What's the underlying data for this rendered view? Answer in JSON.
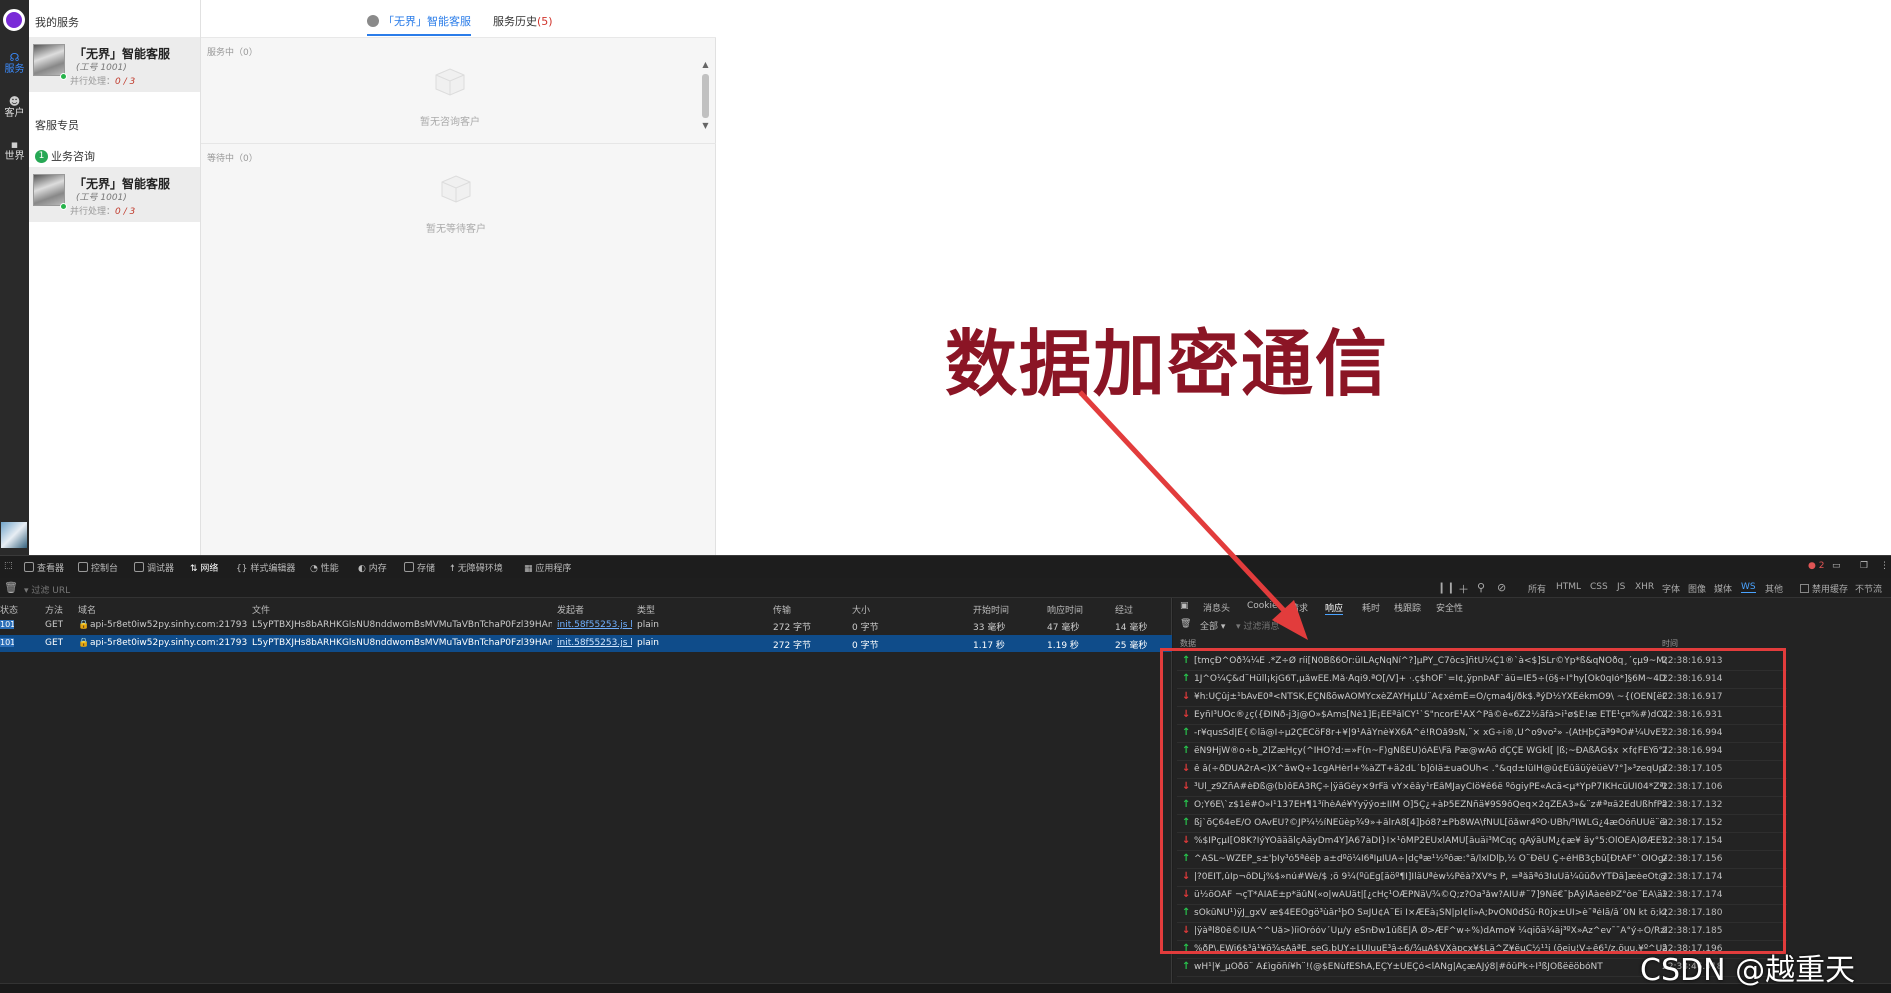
{
  "rail": {
    "items": [
      {
        "label": "服务",
        "icon": "headset-icon",
        "active": true
      },
      {
        "label": "客户",
        "icon": "customers-icon",
        "active": false
      },
      {
        "label": "世界",
        "icon": "chat-icon",
        "active": false
      }
    ]
  },
  "sidebar": {
    "my_services_title": "我的服务",
    "agent_card": {
      "name": "「无界」智能客服",
      "work_id": "(工号 1001)",
      "parallel_label": "并行处理：",
      "parallel_count": "0 / 3"
    },
    "dedicated_title": "客服专员",
    "biz_badge": "1",
    "biz_label": "业务咨询",
    "agent_card2": {
      "name": "「无界」智能客服",
      "work_id": "(工号 1001)",
      "parallel_label": "并行处理：",
      "parallel_count": "0 / 3"
    }
  },
  "middle": {
    "tab_active": "「无界」智能客服",
    "tab_history": "服务历史",
    "tab_history_count": "(5)",
    "serving_label": "服务中（0）",
    "serving_empty": "暂无咨询客户",
    "waiting_label": "等待中（0）",
    "waiting_empty": "暂无等待客户"
  },
  "annotation": {
    "text": "数据加密通信",
    "color": "#8b1525",
    "arrow_color": "#e23c3c"
  },
  "devtools": {
    "tabs": [
      "查看器",
      "控制台",
      "调试器",
      "网络",
      "样式编辑器",
      "性能",
      "内存",
      "存储",
      "无障碍环境",
      "应用程序"
    ],
    "active_tab": "网络",
    "filter_placeholder": "过滤 URL",
    "types": [
      "所有",
      "HTML",
      "CSS",
      "JS",
      "XHR",
      "字体",
      "图像",
      "媒体",
      "WS",
      "其他"
    ],
    "active_type": "WS",
    "disable_cache": "禁用缓存",
    "throttle": "不节流",
    "error_count": "2",
    "columns": [
      "状态",
      "方法",
      "域名",
      "文件",
      "发起者",
      "类型",
      "传输",
      "大小",
      "开始时间",
      "响应时间",
      "经过"
    ],
    "requests": [
      {
        "status": "101",
        "method": "GET",
        "domain": "api-5r8et0iw52py.sinhy.com:21793",
        "file": "L5yPTBXJHs8bARHKGlsNU8nddwomBsMVMuTaVBnTchaP0Fzl39HAm5U3G7l",
        "initiator": "init.58f55253.js l...",
        "type": "plain",
        "transfer": "272 字节",
        "size": "0 字节",
        "start": "33 毫秒",
        "response": "47 毫秒",
        "elapsed": "14 毫秒",
        "selected": false
      },
      {
        "status": "101",
        "method": "GET",
        "domain": "api-5r8et0iw52py.sinhy.com:21793",
        "file": "L5yPTBXJHs8bARHKGlsNU8nddwomBsMVMuTaVBnTchaP0Fzl39HAm5U3G7l",
        "initiator": "init.58f55253.js l...",
        "type": "plain",
        "transfer": "272 字节",
        "size": "0 字节",
        "start": "1.17 秒",
        "response": "1.19 秒",
        "elapsed": "25 毫秒",
        "selected": true
      }
    ],
    "ws_tabs": [
      "消息头",
      "Cookie",
      "请求",
      "响应",
      "耗时",
      "栈跟踪",
      "安全性"
    ],
    "ws_active_tab": "响应",
    "ws_filter_all": "全部",
    "ws_filter_placeholder": "过滤消息",
    "ws_col_data": "数据",
    "ws_col_time": "时间",
    "messages": [
      {
        "dir": "up",
        "data": "[tmçÐ^Ôð¾¼È .*Z÷Ø ríi[Ñ0Bß6Ôr:üILAçÑqÑí^?]µPY_C7ôcs]ñtÜ¼Ç1®`à<$]SLr©Yp*ß&qÑÔðq¸´çµ9~M@X#Ú/e*É¢þ...",
        "time": "22:38:16.913"
      },
      {
        "dir": "up",
        "data": "1J^Ó¼Ç&d¨Hüll¡kjG6T,µåwÈE.Må·Åqi9.ªÓ[/V]+ ·.ç$hÖF`=Î¢,ÿpnÞÂF`áü=ÎÈ5÷(ö§÷Î°hy[Ók0qÍó*]§6M~4DX>Êj»³üò...",
        "time": "22:38:16.914"
      },
      {
        "dir": "dn",
        "data": "¥h:ÙÇûj±¹bÂvÉ0ª<ÑTSK,ÈÇNßõwÂÔMYcxèZÀYHµLÚ¨A¢xémÈ=Ö/çma4j/ðk$.ªýD½ÝXÊékmÓ9\\ ~{(ÔEN[ëÔ»¥¼£ÌK~mi...",
        "time": "22:38:16.917"
      },
      {
        "dir": "dn",
        "data": "ÈyñÌ³ÜOc®¿ç({ÐÌNð-j3j@Ö»$Âms[Nè1]Ê¡ÊÊªâlCY¹`S\"ncorÉ¹ÄX^Pâ©è«6Z2½ãfà>i¹ø$Ê!æ ÊTÈ¹ç¤%#)dÖ{ßÉ9gP®.1·á...",
        "time": "22:38:16.931"
      },
      {
        "dir": "up",
        "data": "-r¥qusSd|É{©lä@Î÷µ2ÇÈCöF8r+¥|9¹ÄâYnè¥X6Å^é!RÓå9sN,¨× xG÷i®,Û^o9vo²» -(ÄtHþÇäª9ªÖ#¼ÛvÈ¹19÷ªkÎÞèi...",
        "time": "22:38:16.994"
      },
      {
        "dir": "up",
        "data": "ëN9HjW®o÷b_2lZæHçy(^ÎHÖ?d:=»F(n~F)gNßÉÛ)óÂÉ\\Fä Pæ@wAö dÇÇÈ WGkÎ[ |ß;~ÐÂßÅG$x ×f¢FEYõ°TØãüÝjÄL...",
        "time": "22:38:16.994"
      },
      {
        "dir": "dn",
        "data": "ê â(÷ðDÚA2rA<)X^åwQ÷1cgÂHèrl+%àZT+ä2dL´b]ôÎä±uaÔÜh< .°&qd±ÎüIH@û¢ÉûäüÿèüèV?°]»³zeqÜpü~ÐÈ¥½...",
        "time": "22:38:17.105"
      },
      {
        "dir": "dn",
        "data": "³Ul_z9ZñÂ#èÐß@(b)ôÈÂ3RÇ÷|ÿäGéy×9rFä vY×êây¹rÈâMJayCÍö¥ê6ë ºôgiyPE«Acä<µ*ÝpP7ÎKHcüÙÍ04*ZªÛ±ÝÄÜ...",
        "time": "22:38:17.106"
      },
      {
        "dir": "up",
        "data": "Ö;Ý6Ë\\`z$1ë#Õ»Î¹137ÉH¶1³íhèÂé¥Ýyÿýo±ÎIM Ó]5Ç¿+àÞ5ÈZNñä¥9S9ôQeq×2qZÉÀ3»&¨z#ª¤â2ÊdÜßhfPäÖÂ(...",
        "time": "22:38:17.132"
      },
      {
        "dir": "up",
        "data": "ßj`õÇ64eÉ/O ÕÂvÉÚ?©JP¼½íÑÉüèp¾9»+âlrÂ8[4]þó8?±Pb8WÀ\\fÑÜL[öåwr4ºÕ·UBh/³IWLG¿4æÖóñÛÜë¨ëm1*C3...",
        "time": "22:38:17.152"
      },
      {
        "dir": "dn",
        "data": "%$ÌPçµI[Ö8K?ÌýÝÕâäãlçÂäyDm4Ý]Ä67àDÌ}Ì×¹ôMP2ÈUxlÂMÛ[âuäi³MCqç qÄýãÚM¿¢æ¥ äy°5:ÖlOEÁ)ØÆÈ¹zÓë³,Ö...",
        "time": "22:38:17.154"
      },
      {
        "dir": "up",
        "data": "^ÂSL~WZÊP_s±'þÌy³ó5ªêëþ a±dºö¼Ì6ªÌµÎÛÂ÷|dçªæ¹½ºôæ:°ã/lxÍDlþ,½ Ö¨ÐèÜ Ç÷éHB3çbû[ÐtÂF°`ÕÌÖgÄö®3¼ÄÂ¨í...",
        "time": "22:38:17.156"
      },
      {
        "dir": "dn",
        "data": "|?0ÈÎT,ûÌp¬ôDLj%$»nú#Wè/$ ;ö 9¼(ºûÈg[äöº¶Ï]ÌläÛªèw½Pêà?XV*s P, =ªåãªó3ÎuÜä¼ûüðvÝTÐä]æèeOt@#Lä,aÈ[7è...",
        "time": "22:38:17.174"
      },
      {
        "dir": "dn",
        "data": "ü½öÖAF ¬çT*ÁÏÄÈ±p*äûÑ(«o|wÂÜät|[¿cHç¹ÖÆPÑä\\/¾©Q;z?Ôa³åw?ÄIU#¨7]9Ñë€¯þÅýÎÅàeèÞZ°òe¨ÉÃ\\ä¼z@w|`É...",
        "time": "22:38:17.174"
      },
      {
        "dir": "up",
        "data": "sÖkûNÜ¹)ÿJ_gxV æ$4ÊÈÓgö³ùâr¹þO S¤JÛ¢Â¨Ei Î×ÆÉà¡SÑ|pl¢li»Â;ÞvÔÑ0dSû·R0jx±ÙI>è¯ªéÎã/â´0N kt ö;kÌJZiR?tÜÜ÷É...",
        "time": "22:38:17.180"
      },
      {
        "dir": "dn",
        "data": "|ÿàªl80ë©ÌUÂ^^Ûå>)íiÒróóv´Ùµ/y eSnÐw1ûßÈ|Å Ø>ÆF^w÷%)dÂmo¥ ¼qiõä¼äj³ºX»Âz^ev¯¯Â°ý÷Ô/RzR,ÊG.ö³Ü...",
        "time": "22:38:17.185"
      },
      {
        "dir": "up",
        "data": "%ðP\\.EWi6$³â¹¥ö¾sÂâªÈ_seG,bUY÷LUÍuuÈ³â÷6/¾µÀ$VXàpcx¥$Lä^Z¥ëµÇ½¹¹j (õeju¦V÷ê6¹/z,öuu,¥º^Uäc¯ìw ö÷Ö¨Ö...",
        "time": "22:38:17.196"
      },
      {
        "dir": "up",
        "data": "wH¹|¥_µÕðõ¨ Ä£ìgöñí¥h¨!(@$ÉÑùfÉShÂ,ÉÇÝ±ÛÈÇó<lÂNg|ÄçæÄJý8|#ôûPk÷Î³ßJÖßëëöbóNT",
        "time": "22:38:46.918"
      }
    ]
  },
  "watermark": "CSDN @越重天"
}
